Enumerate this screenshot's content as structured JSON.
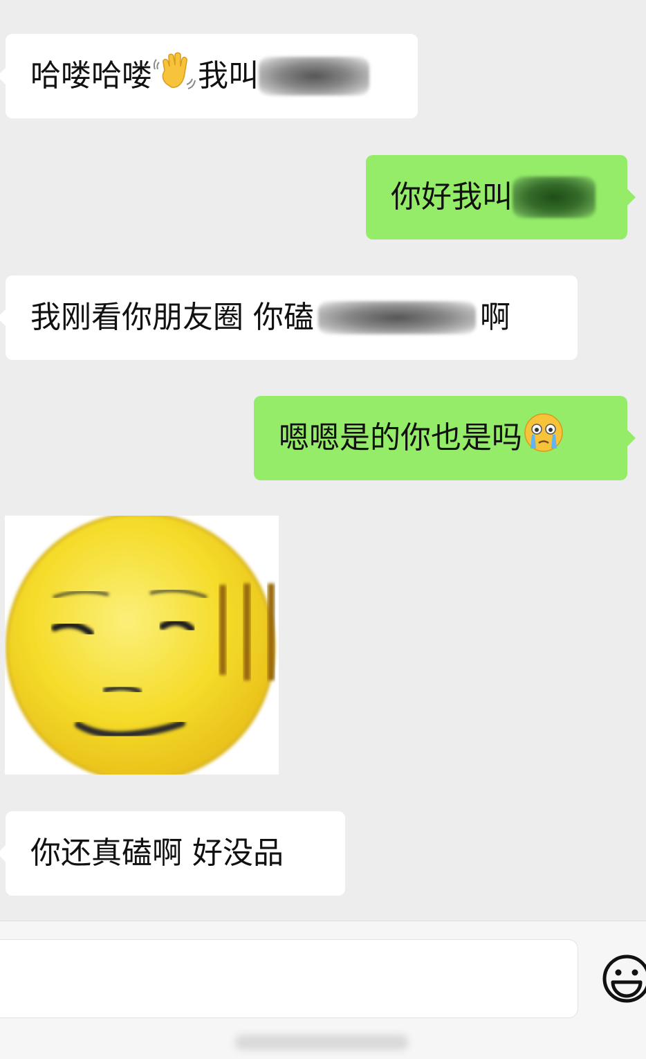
{
  "messages": [
    {
      "id": "msg1",
      "side": "incoming",
      "before": "哈喽哈喽",
      "emoji": "waving-hand-icon",
      "mid": "我叫",
      "after": ""
    },
    {
      "id": "msg2",
      "side": "outgoing",
      "before": "你好我叫",
      "after": ""
    },
    {
      "id": "msg3",
      "side": "incoming",
      "before": "我刚看你朋友圈 你磕",
      "after": "啊"
    },
    {
      "id": "msg4",
      "side": "outgoing",
      "text": "嗯嗯是的你也是吗",
      "emoji": "crying-face-icon"
    },
    {
      "id": "sticker",
      "side": "incoming",
      "type": "sticker",
      "icon": "speechless-face-sticker"
    },
    {
      "id": "msg5",
      "side": "incoming",
      "text": "你还真磕啊 好没品"
    }
  ],
  "input": {
    "placeholder": ""
  },
  "colors": {
    "background": "#ededed",
    "incoming": "#ffffff",
    "outgoing": "#95ec69",
    "sticker_yellow": "#f5dc2a"
  }
}
